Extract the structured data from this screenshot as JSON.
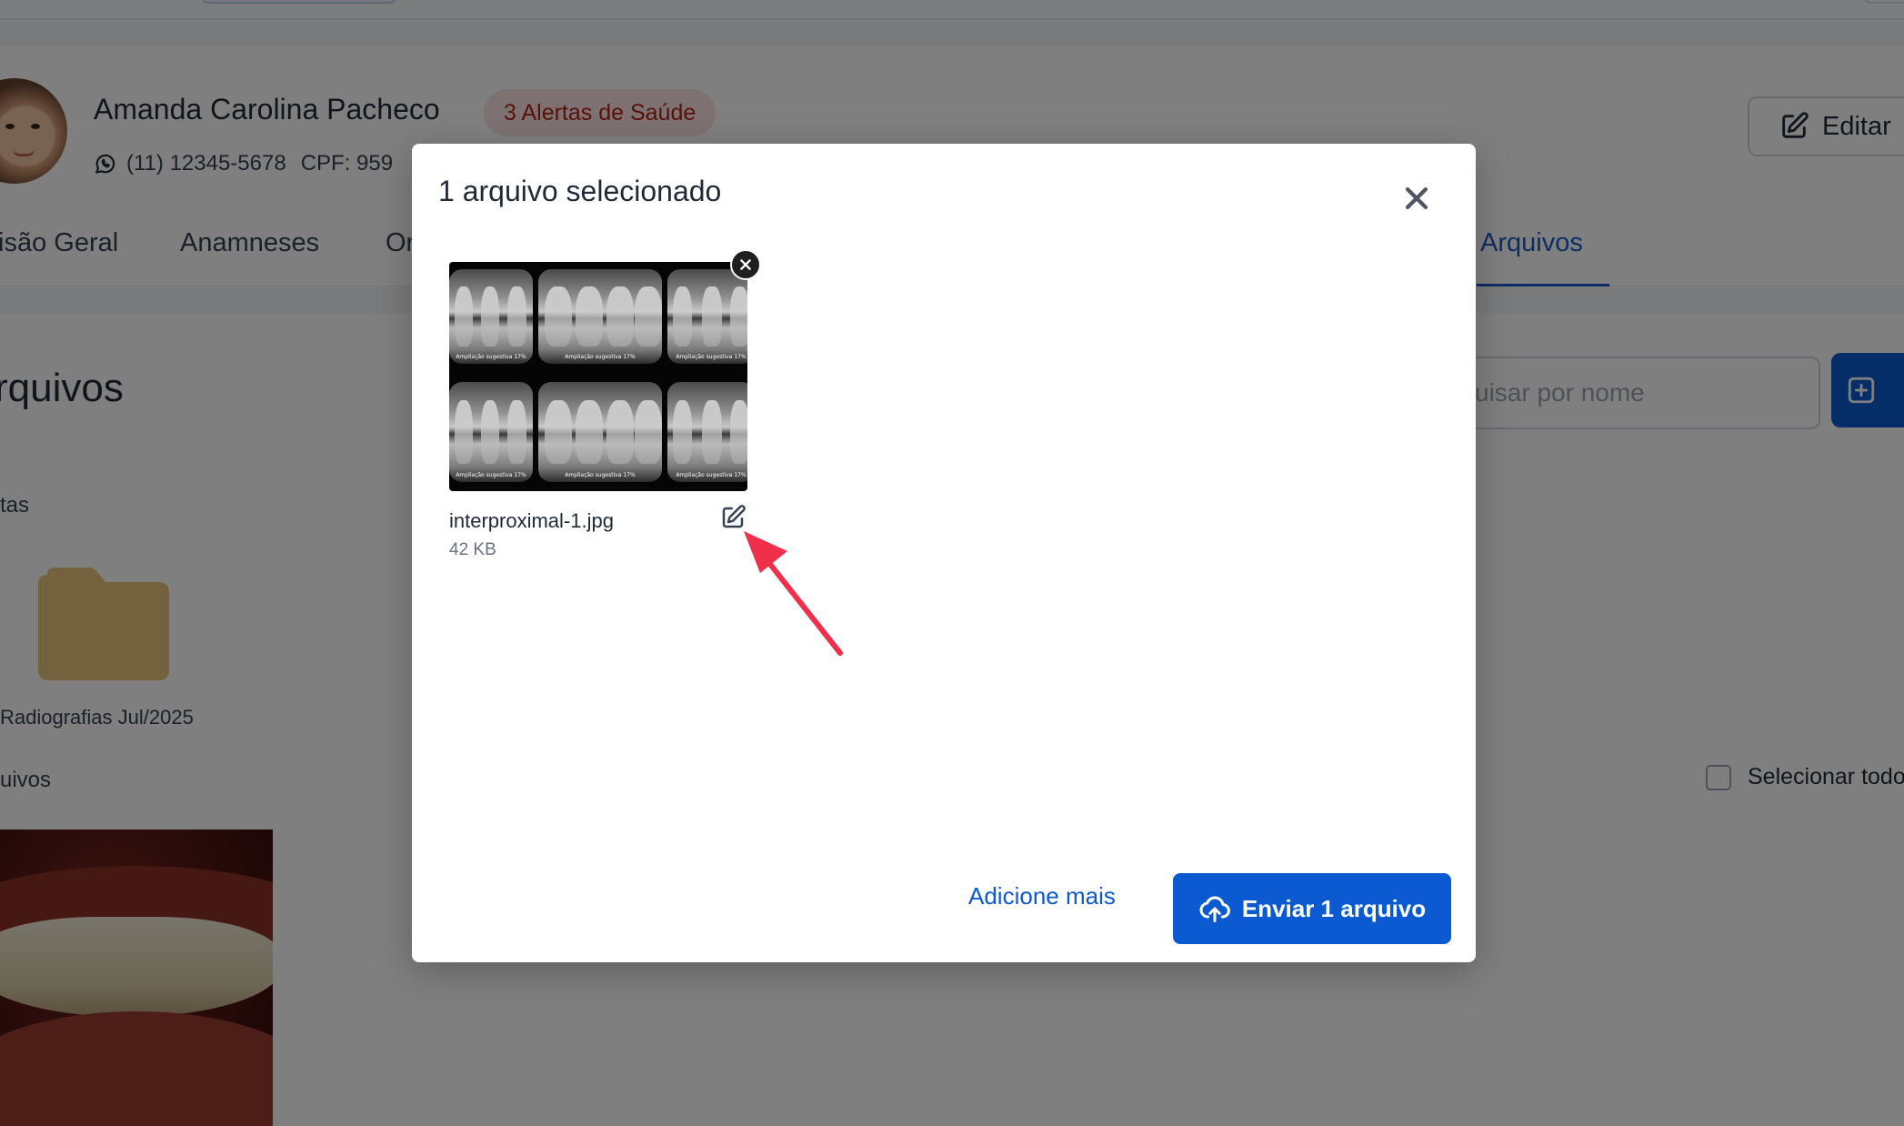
{
  "patient": {
    "name": "Amanda Carolina Pacheco",
    "alerts_badge": "3 Alertas de Saúde",
    "phone": "(11) 12345-5678",
    "cpf_partial": "CPF: 959"
  },
  "header": {
    "edit_label": "Editar"
  },
  "tabs": [
    {
      "label": "isão Geral"
    },
    {
      "label": "Anamneses"
    },
    {
      "label": "Or"
    },
    {
      "label": "Arquivos",
      "active": true
    }
  ],
  "files_section": {
    "title": "rquivos",
    "search_placeholder": "uisar por nome",
    "folders_label": "tas",
    "folder_name": "Radiografias Jul/2025",
    "files_label": "uivos",
    "select_all_label": "Selecionar todo"
  },
  "modal": {
    "title": "1 arquivo selecionado",
    "file": {
      "name": "interproximal-1.jpg",
      "size": "42 KB",
      "xray_caption": "Ampliação sugestiva 17%"
    },
    "add_more_label": "Adicione mais",
    "send_label": "Enviar 1 arquivo"
  },
  "colors": {
    "primary": "#0b5ad1",
    "alert_bg": "#fde2e2",
    "alert_text": "#b42318",
    "folder": "#e8c27a",
    "annotation_arrow": "#f0304a"
  },
  "icons": {
    "whatsapp": "whatsapp-icon",
    "edit": "pencil-square-icon",
    "close": "close-icon",
    "upload": "cloud-upload-icon",
    "add": "plus-square-icon",
    "folder": "folder-icon"
  }
}
